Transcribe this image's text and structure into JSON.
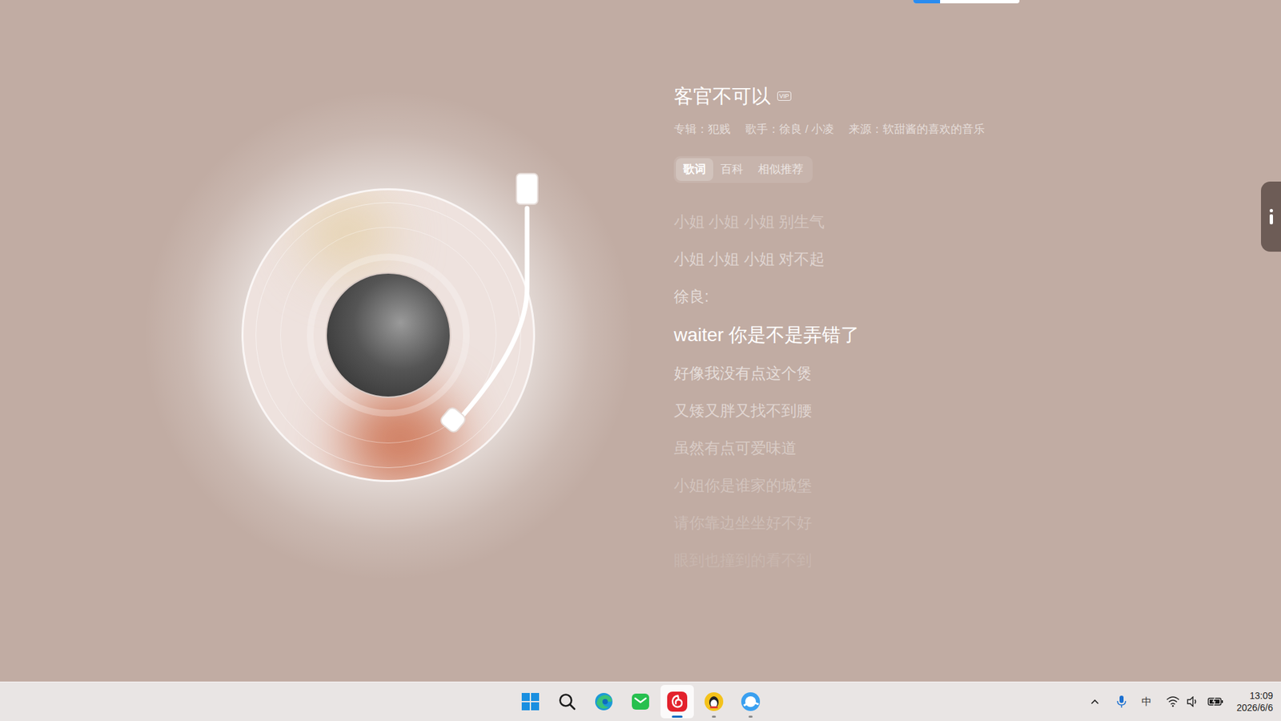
{
  "song": {
    "title": "客官不可以",
    "badge": "VIP",
    "meta": [
      {
        "label": "专辑：",
        "value": "犯贱"
      },
      {
        "label": "歌手：",
        "value": "徐良 / 小凌"
      },
      {
        "label": "来源：",
        "value": "软甜酱的喜欢的音乐"
      }
    ]
  },
  "tabs": [
    {
      "label": "歌词",
      "selected": true
    },
    {
      "label": "百科",
      "selected": false
    },
    {
      "label": "相似推荐",
      "selected": false
    }
  ],
  "lyrics": [
    {
      "text": "小姐 小姐 小姐 别生气",
      "current": false
    },
    {
      "text": "小姐 小姐 小姐 对不起",
      "current": false
    },
    {
      "text": "徐良:",
      "current": false
    },
    {
      "text": "waiter 你是不是弄错了",
      "current": true
    },
    {
      "text": "好像我没有点这个煲",
      "current": false
    },
    {
      "text": "又矮又胖又找不到腰",
      "current": false
    },
    {
      "text": "虽然有点可爱味道",
      "current": false
    },
    {
      "text": "小姐你是谁家的城堡",
      "current": false
    },
    {
      "text": "请你靠边坐坐好不好",
      "current": false
    },
    {
      "text": "眼到也撞到的看不到",
      "current": false
    }
  ],
  "taskbar": {
    "apps": [
      {
        "kind": "start",
        "active": false,
        "running": false
      },
      {
        "kind": "search",
        "active": false,
        "running": false
      },
      {
        "kind": "edge",
        "active": false,
        "running": false
      },
      {
        "kind": "chat",
        "active": false,
        "running": false
      },
      {
        "kind": "netease",
        "active": true,
        "running": true
      },
      {
        "kind": "qq",
        "active": false,
        "running": true
      },
      {
        "kind": "browser",
        "active": false,
        "running": true
      }
    ]
  },
  "tray": {
    "ime": "中",
    "time": "13:09",
    "date": "2026/6/6"
  }
}
